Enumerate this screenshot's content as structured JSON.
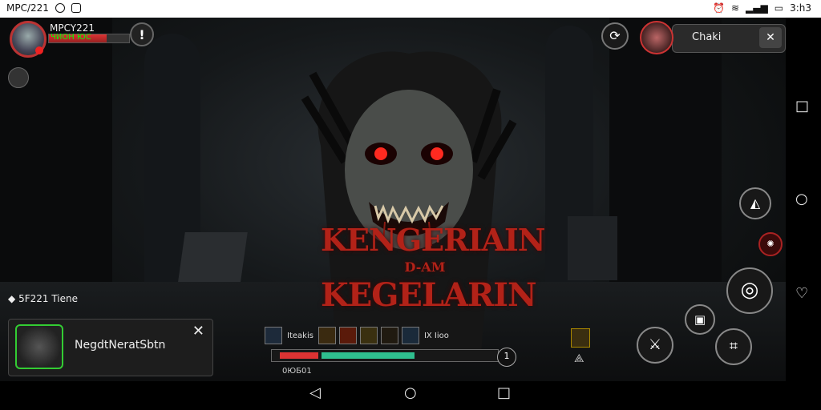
{
  "status_bar": {
    "app_label": "MPC/221",
    "time": "3:h3"
  },
  "player": {
    "name": "MPCY221",
    "hp_text": "ЧИОН ЮС",
    "hp_fraction": 0.72
  },
  "title": {
    "line1": "KENGERIAIN",
    "line2": "D-AM",
    "line3": "KEGELARIN"
  },
  "chat": {
    "label": "Chaki"
  },
  "feed": {
    "text": "5F221 Tiene"
  },
  "notification": {
    "text": "NegdtNeratSbtn"
  },
  "hud": {
    "skill_labels": [
      "Iteakis",
      "IX Iioo"
    ],
    "xp_level": "1",
    "xp_label": "0ЮБ01",
    "xp_red_fraction": 0.18,
    "xp_green_fraction": 0.44
  },
  "colors": {
    "accent_red": "#b22218",
    "xp_green": "#2fbf8f",
    "hp_red": "#d33333"
  }
}
